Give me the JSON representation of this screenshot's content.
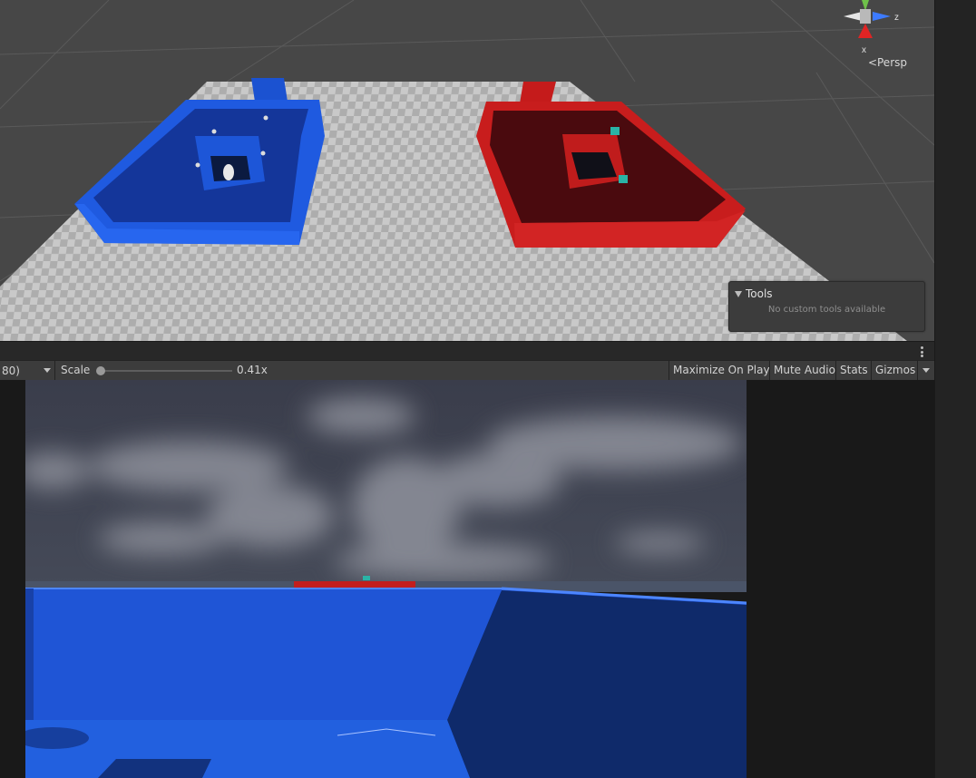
{
  "scene_view": {
    "projection_label": "Persp",
    "gizmo_axes": {
      "z": "z",
      "x": "x"
    },
    "tools_panel": {
      "title": "Tools",
      "empty_text": "No custom tools available"
    },
    "colors": {
      "background": "#474747",
      "ground_light": "#c9c9c9",
      "ground_dark": "#aeaeae",
      "blue_base": "#1d58d8",
      "red_base": "#cc1a1a"
    }
  },
  "game_toolbar": {
    "resolution_text": "80)",
    "scale_label": "Scale",
    "scale_value": "0.41x",
    "scale_fraction": 0.0,
    "maximize_label": "Maximize On Play",
    "mute_label": "Mute Audio",
    "stats_label": "Stats",
    "gizmos_label": "Gizmos"
  },
  "game_view": {
    "colors": {
      "sky": "#3f4250",
      "wall_near": "#1f55d6",
      "wall_dark": "#0f2a6a",
      "floor": "#2260df"
    }
  },
  "icons": [
    "transform-gizmo-icon",
    "persp-arrow-icon",
    "tools-triangle-icon",
    "more-options-icon",
    "dropdown-arrow-icon"
  ]
}
